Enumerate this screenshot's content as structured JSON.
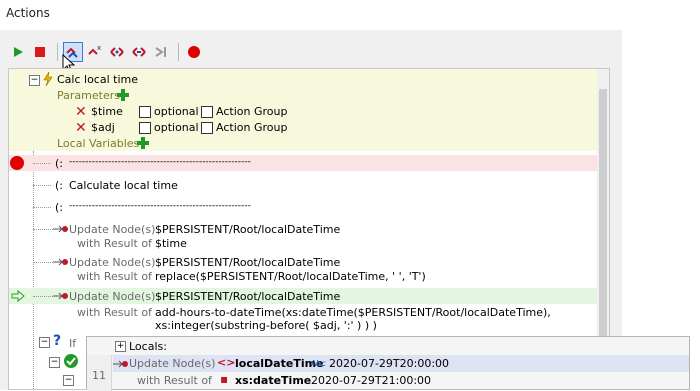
{
  "panel_title": "Actions",
  "toolbar": {
    "buttons": [
      {
        "name": "run-button",
        "icon": "play-icon",
        "color": "#1f9a2a"
      },
      {
        "name": "stop-button",
        "icon": "stop-icon",
        "color": "#d81c1c"
      },
      {
        "name": "step-into-button",
        "icon": "step-into-icon",
        "color": "#c0172b",
        "active": true
      },
      {
        "name": "step-out-button",
        "icon": "step-out-icon",
        "color": "#c0172b"
      },
      {
        "name": "step-over-button",
        "icon": "step-over-icon",
        "color": "#c0172b"
      },
      {
        "name": "step-over-back-button",
        "icon": "step-over-back-icon",
        "color": "#c0172b"
      },
      {
        "name": "run-to-cursor-button",
        "icon": "run-to-cursor-icon",
        "color": "#9a9a9a"
      },
      {
        "name": "breakpoint-button",
        "icon": "breakpoint-icon",
        "color": "#e00000"
      }
    ]
  },
  "actions": {
    "action_name": "Calc local time",
    "parameters_label": "Parameters",
    "parameters": [
      {
        "name": "$time",
        "optional_label": "optional",
        "group_label": "Action Group"
      },
      {
        "name": "$adj",
        "optional_label": "optional",
        "group_label": "Action Group"
      }
    ],
    "local_variables_label": "Local Variables",
    "comments": [
      {
        "open": "(:",
        "text": "--------------------------------------------------------"
      },
      {
        "open": "(:",
        "text": "Calculate local time"
      },
      {
        "open": "(:",
        "text": "--------------------------------------------------------"
      }
    ],
    "updates": [
      {
        "keyword": "Update Node(s)",
        "target": "$PERSISTENT/Root/localDateTime",
        "with_label": "with Result of",
        "value": "$time"
      },
      {
        "keyword": "Update Node(s)",
        "target": "$PERSISTENT/Root/localDateTime",
        "with_label": "with Result of",
        "value": "replace($PERSISTENT/Root/localDateTime, ' ', 'T')"
      },
      {
        "keyword": "Update Node(s)",
        "target": "$PERSISTENT/Root/localDateTime",
        "with_label": "with Result of",
        "value": "add-hours-to-dateTime(xs:dateTime($PERSISTENT/Root/localDateTime),",
        "value2": "xs:integer(substring-before( $adj,  ':' ) ) )"
      }
    ],
    "partial_label": "If"
  },
  "locals_tooltip": {
    "header": "Locals:",
    "line_number": "11",
    "keyword": "Update Node(s)",
    "name": "localDateTime",
    "type_badge": "Abc",
    "value": "2020-07-29T20:00:00",
    "with_label": "with Result of",
    "result_type": "xs:dateTime",
    "result_value": "2020-07-29T21:00:00"
  },
  "colors": {
    "header_bg": "#f8f9dc",
    "breakpoint_row": "#fbe3e3",
    "current_row": "#e3f6e0",
    "accent": "#1f9a2a",
    "keyword": "#7a7a7a"
  }
}
